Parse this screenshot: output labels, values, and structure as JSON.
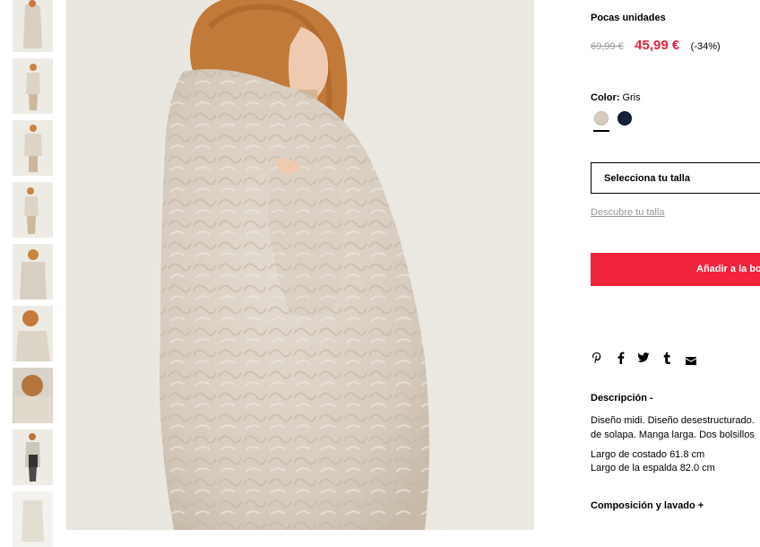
{
  "product": {
    "stock_status": "Pocas unidades",
    "old_price": "69,99 €",
    "new_price": "45,99 €",
    "discount": "(-34%)",
    "color_label": "Color:",
    "color_value": "Gris",
    "colors": [
      {
        "name": "beige",
        "hex": "#d8ccbf",
        "selected": true
      },
      {
        "name": "navy",
        "hex": "#15213a",
        "selected": false
      }
    ],
    "size_select_label": "Selecciona tu talla",
    "size_guide_link": "Descubre tu talla",
    "add_to_bag_label": "Añadir a la bolsa",
    "share_icons": [
      "pinterest-icon",
      "facebook-icon",
      "twitter-icon",
      "tumblr-icon",
      "mail-icon"
    ],
    "description_title": "Descripción -",
    "description_line1": "Diseño midi. Diseño desestructurado.",
    "description_line2": "de solapa. Manga larga. Dos bolsillos",
    "dimension_line1": "Largo de costado 61.8 cm",
    "dimension_line2": "Largo de la espalda 82.0 cm",
    "composition_title": "Composición y lavado +"
  },
  "gallery": {
    "thumbnail_count": 9,
    "accent_colors": {
      "price": "#e8223a",
      "button": "#f2233b",
      "fur": "#d9cfc3",
      "background": "#ebe8e1"
    }
  }
}
